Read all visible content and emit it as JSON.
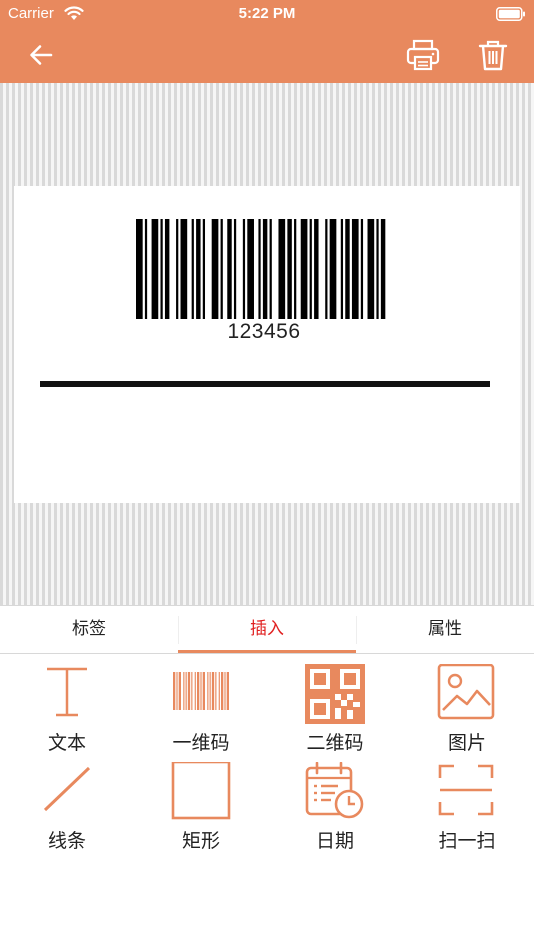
{
  "status_bar": {
    "carrier": "Carrier",
    "time": "5:22 PM"
  },
  "label_canvas": {
    "barcode_value": "123456"
  },
  "tabs": [
    {
      "label": "标签",
      "active": false
    },
    {
      "label": "插入",
      "active": true
    },
    {
      "label": "属性",
      "active": false
    }
  ],
  "tools": [
    {
      "label": "文本",
      "icon": "text-icon"
    },
    {
      "label": "一维码",
      "icon": "barcode-icon"
    },
    {
      "label": "二维码",
      "icon": "qrcode-icon"
    },
    {
      "label": "图片",
      "icon": "image-icon"
    },
    {
      "label": "线条",
      "icon": "line-icon"
    },
    {
      "label": "矩形",
      "icon": "rectangle-icon"
    },
    {
      "label": "日期",
      "icon": "calendar-icon"
    },
    {
      "label": "扫一扫",
      "icon": "scan-icon"
    }
  ],
  "colors": {
    "accent": "#E8895E",
    "active_tab_text": "#E02020"
  }
}
